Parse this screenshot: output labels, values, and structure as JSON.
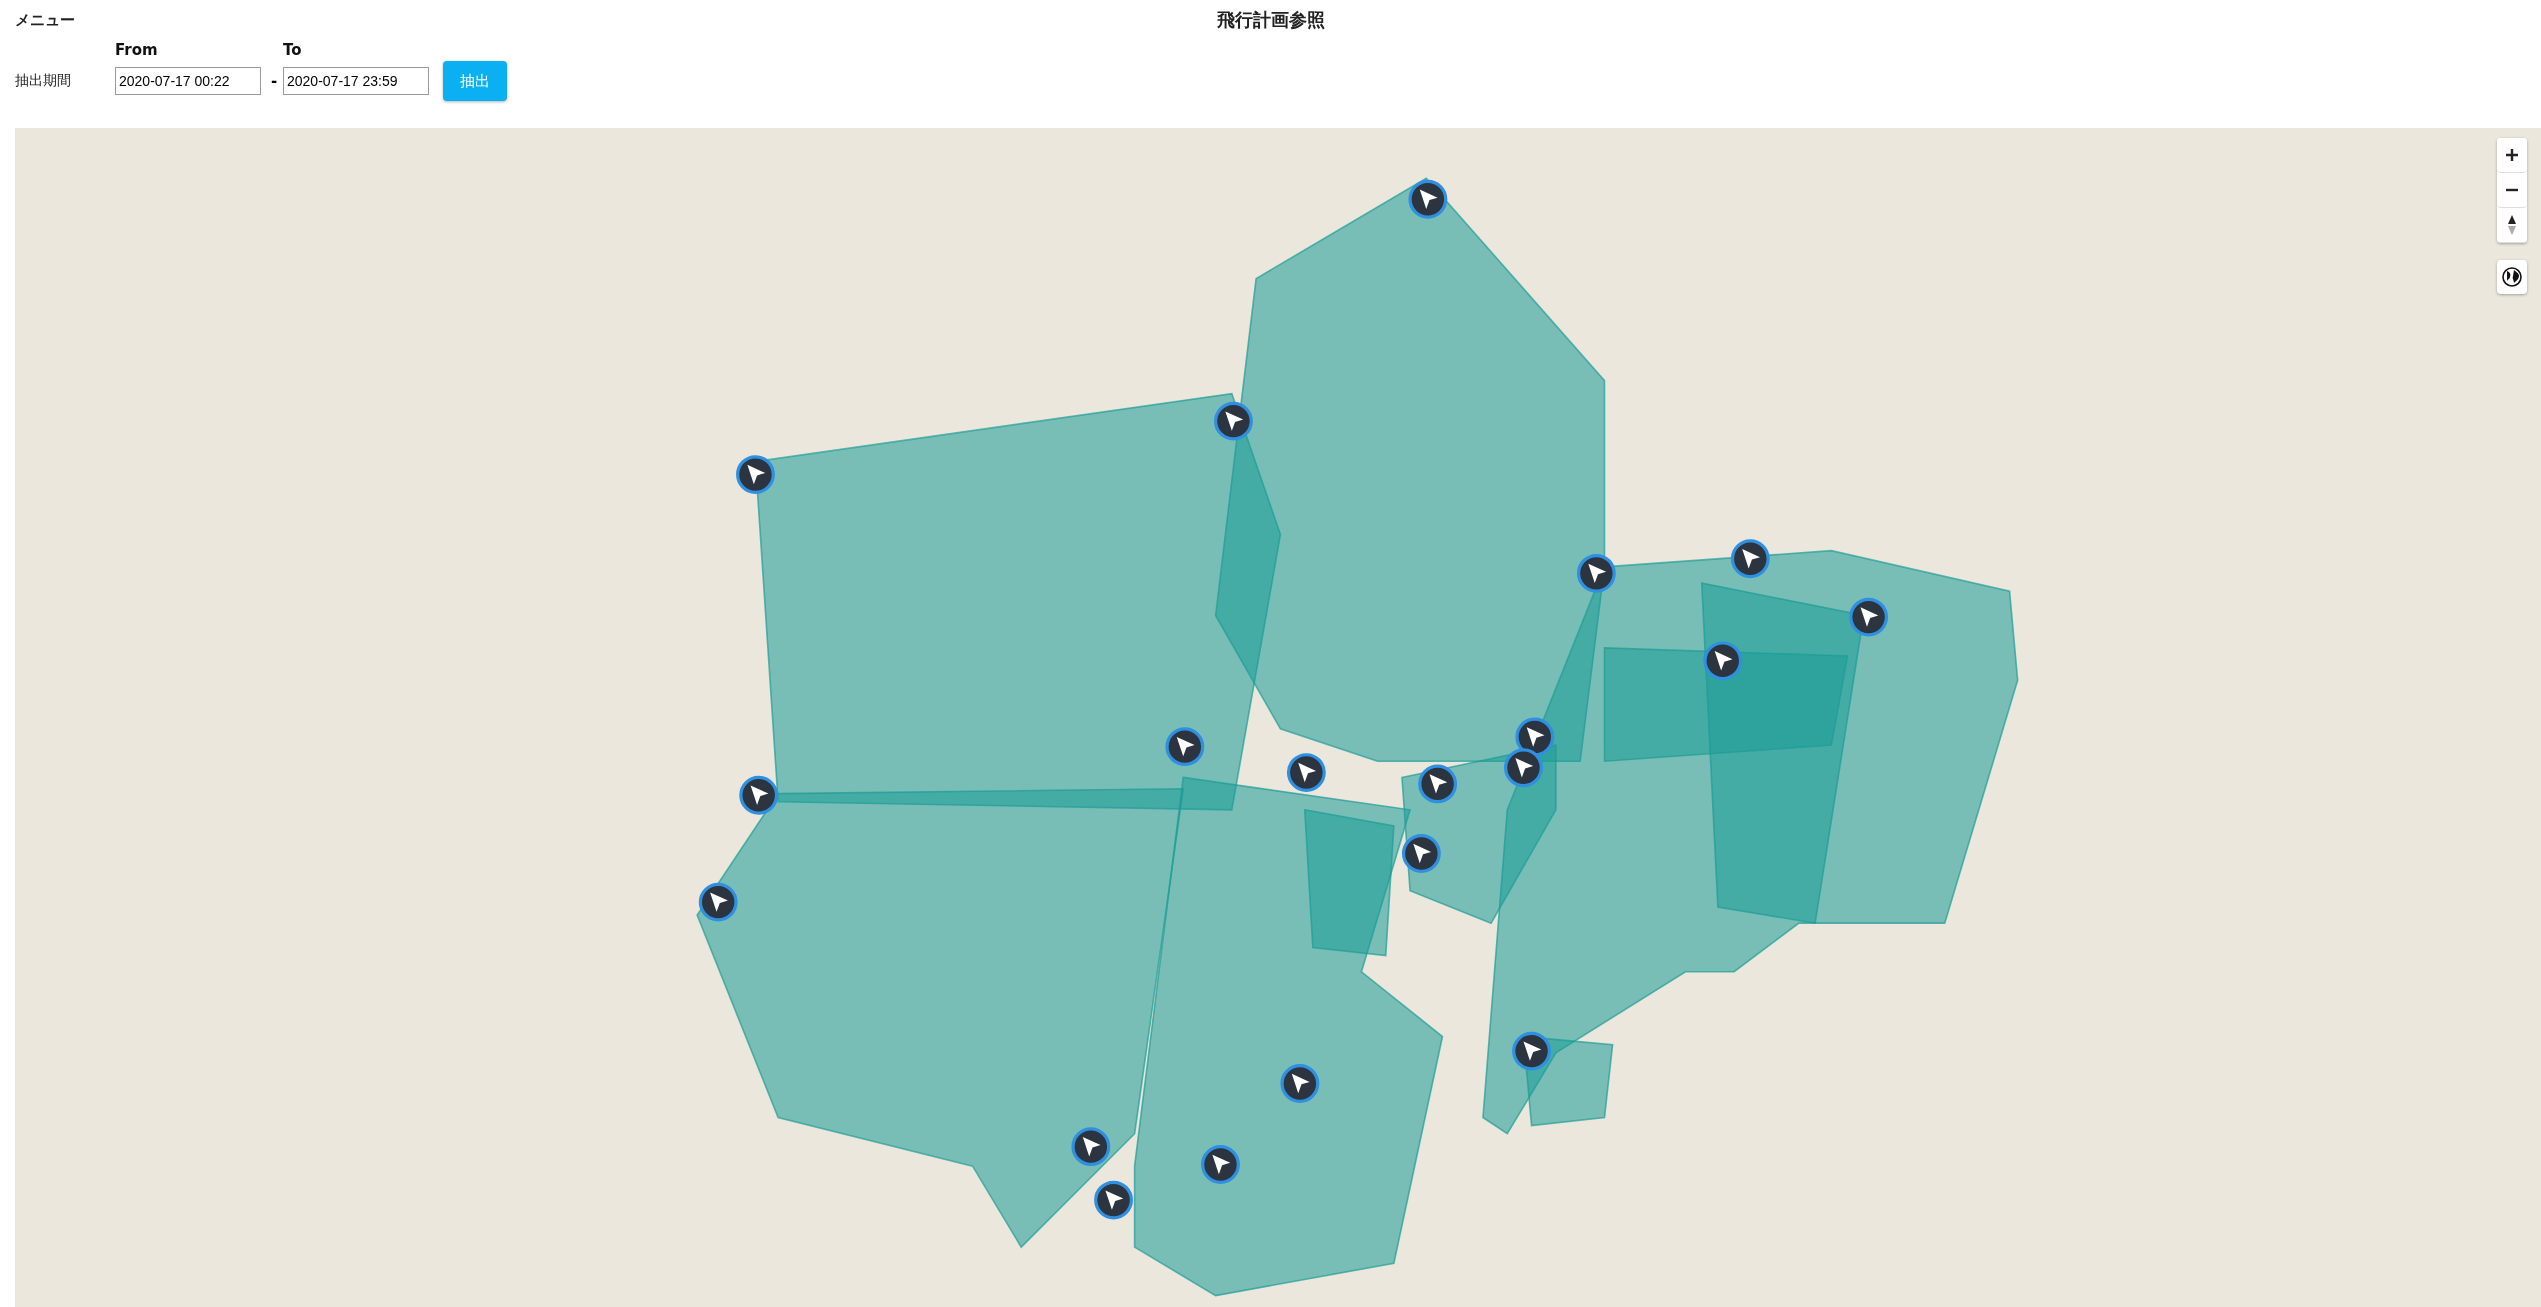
{
  "menu": "メニュー",
  "title": "飛行計画参照",
  "filter": {
    "label": "抽出期間",
    "from": {
      "label": "From",
      "value": "2020-07-17 00:22"
    },
    "separator": "-",
    "to": {
      "label": "To",
      "value": "2020-07-17 23:59"
    },
    "button": "抽出"
  }
}
